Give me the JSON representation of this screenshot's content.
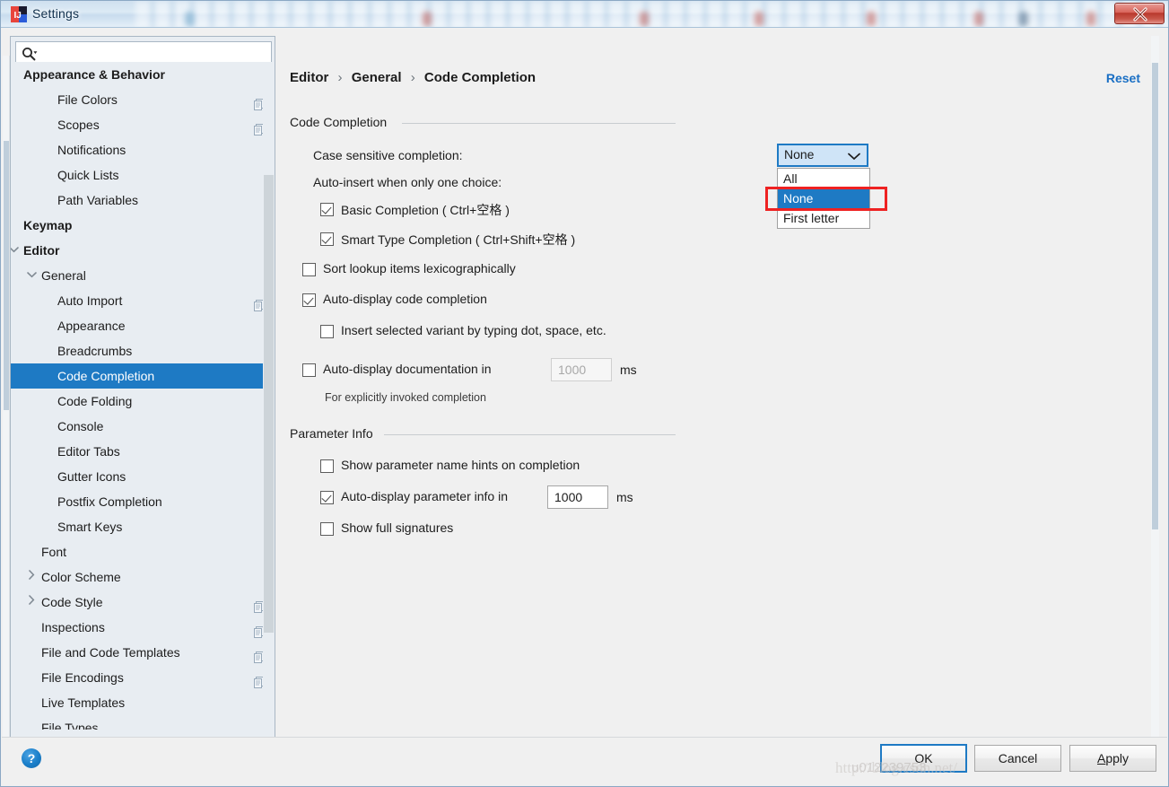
{
  "window": {
    "title": "Settings",
    "app_icon": "intellij-idea-icon",
    "close_label": "Close"
  },
  "search": {
    "placeholder": "",
    "value": "",
    "icon": "search-icon"
  },
  "sidebar": {
    "items": [
      {
        "label": "Appearance & Behavior",
        "indent": 14,
        "bold": true,
        "arrow": "",
        "badge": false,
        "selected": false
      },
      {
        "label": "File Colors",
        "indent": 52,
        "bold": false,
        "arrow": "",
        "badge": true,
        "selected": false
      },
      {
        "label": "Scopes",
        "indent": 52,
        "bold": false,
        "arrow": "",
        "badge": true,
        "selected": false
      },
      {
        "label": "Notifications",
        "indent": 52,
        "bold": false,
        "arrow": "",
        "badge": false,
        "selected": false
      },
      {
        "label": "Quick Lists",
        "indent": 52,
        "bold": false,
        "arrow": "",
        "badge": false,
        "selected": false
      },
      {
        "label": "Path Variables",
        "indent": 52,
        "bold": false,
        "arrow": "",
        "badge": false,
        "selected": false
      },
      {
        "label": "Keymap",
        "indent": 14,
        "bold": true,
        "arrow": "",
        "badge": false,
        "selected": false
      },
      {
        "label": "Editor",
        "indent": 14,
        "bold": true,
        "arrow": "v",
        "badge": false,
        "selected": false
      },
      {
        "label": "General",
        "indent": 34,
        "bold": false,
        "arrow": "v",
        "badge": false,
        "selected": false
      },
      {
        "label": "Auto Import",
        "indent": 52,
        "bold": false,
        "arrow": "",
        "badge": true,
        "selected": false
      },
      {
        "label": "Appearance",
        "indent": 52,
        "bold": false,
        "arrow": "",
        "badge": false,
        "selected": false
      },
      {
        "label": "Breadcrumbs",
        "indent": 52,
        "bold": false,
        "arrow": "",
        "badge": false,
        "selected": false
      },
      {
        "label": "Code Completion",
        "indent": 52,
        "bold": false,
        "arrow": "",
        "badge": false,
        "selected": true
      },
      {
        "label": "Code Folding",
        "indent": 52,
        "bold": false,
        "arrow": "",
        "badge": false,
        "selected": false
      },
      {
        "label": "Console",
        "indent": 52,
        "bold": false,
        "arrow": "",
        "badge": false,
        "selected": false
      },
      {
        "label": "Editor Tabs",
        "indent": 52,
        "bold": false,
        "arrow": "",
        "badge": false,
        "selected": false
      },
      {
        "label": "Gutter Icons",
        "indent": 52,
        "bold": false,
        "arrow": "",
        "badge": false,
        "selected": false
      },
      {
        "label": "Postfix Completion",
        "indent": 52,
        "bold": false,
        "arrow": "",
        "badge": false,
        "selected": false
      },
      {
        "label": "Smart Keys",
        "indent": 52,
        "bold": false,
        "arrow": "",
        "badge": false,
        "selected": false
      },
      {
        "label": "Font",
        "indent": 34,
        "bold": false,
        "arrow": "",
        "badge": false,
        "selected": false
      },
      {
        "label": "Color Scheme",
        "indent": 34,
        "bold": false,
        "arrow": ">",
        "badge": false,
        "selected": false
      },
      {
        "label": "Code Style",
        "indent": 34,
        "bold": false,
        "arrow": ">",
        "badge": true,
        "selected": false
      },
      {
        "label": "Inspections",
        "indent": 34,
        "bold": false,
        "arrow": "",
        "badge": true,
        "selected": false
      },
      {
        "label": "File and Code Templates",
        "indent": 34,
        "bold": false,
        "arrow": "",
        "badge": true,
        "selected": false
      },
      {
        "label": "File Encodings",
        "indent": 34,
        "bold": false,
        "arrow": "",
        "badge": true,
        "selected": false
      },
      {
        "label": "Live Templates",
        "indent": 34,
        "bold": false,
        "arrow": "",
        "badge": false,
        "selected": false
      },
      {
        "label": "File Types",
        "indent": 34,
        "bold": false,
        "arrow": "",
        "badge": false,
        "selected": false
      }
    ]
  },
  "breadcrumb": {
    "part1": "Editor",
    "part2": "General",
    "part3": "Code Completion",
    "separator": "›"
  },
  "reset": {
    "label": "Reset"
  },
  "sections": {
    "code_completion": "Code Completion",
    "parameter_info": "Parameter Info"
  },
  "code_completion": {
    "case_sensitive_label": "Case sensitive completion:",
    "case_sensitive_value": "None",
    "case_sensitive_options": [
      "All",
      "None",
      "First letter"
    ],
    "auto_insert_label": "Auto-insert when only one choice:",
    "basic_completion": "Basic Completion ( Ctrl+空格 )",
    "smart_type_completion": "Smart Type Completion ( Ctrl+Shift+空格 )",
    "sort_lookup": "Sort lookup items lexicographically",
    "auto_display_code_completion": "Auto-display code completion",
    "insert_selected_variant": "Insert selected variant by typing dot, space, etc.",
    "auto_display_documentation": "Auto-display documentation in",
    "doc_delay_value": "1000",
    "doc_delay_unit": "ms",
    "doc_hint": "For explicitly invoked completion"
  },
  "parameter_info": {
    "show_param_hints": "Show parameter name hints on completion",
    "auto_display_param_info": "Auto-display parameter info in",
    "param_delay_value": "1000",
    "param_delay_unit": "ms",
    "show_full_signatures": "Show full signatures"
  },
  "footer": {
    "help_glyph": "?",
    "ok": "OK",
    "cancel": "Cancel",
    "apply_prefix": "A",
    "apply_suffix": "pply"
  },
  "watermark": {
    "line1": "http://blog.csdn.net/",
    "line2": "u012239753"
  },
  "colors": {
    "accent": "#1e7ac4",
    "annotation": "#ee2222",
    "link": "#1a6fc4",
    "selection_bg": "#1e7ac4",
    "panel_bg": "#e8edf2",
    "dialog_bg": "#f0f0f0"
  }
}
